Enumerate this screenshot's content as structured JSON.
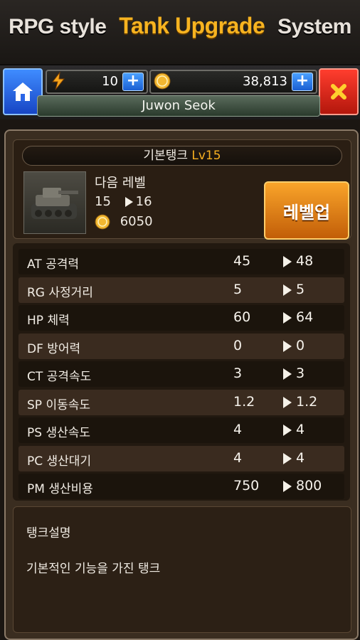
{
  "header": {
    "title_prefix": "RPG style",
    "title_accent": "Tank Upgrade",
    "title_suffix": "System"
  },
  "topbar": {
    "home_icon": "home-icon",
    "energy_value": "10",
    "gold_value": "38,813",
    "player_name": "Juwon Seok",
    "close_icon": "close-icon"
  },
  "tank": {
    "name": "기본탱크",
    "level": "Lv15",
    "next_level_label": "다음 레벨",
    "current_level": "15",
    "next_level": "16",
    "cost": "6050",
    "levelup_label": "레벨업"
  },
  "stats": [
    {
      "name": "AT 공격력",
      "current": "45",
      "next": "48"
    },
    {
      "name": "RG 사정거리",
      "current": "5",
      "next": "5"
    },
    {
      "name": "HP 체력",
      "current": "60",
      "next": "64"
    },
    {
      "name": "DF 방어력",
      "current": "0",
      "next": "0"
    },
    {
      "name": "CT 공격속도",
      "current": "3",
      "next": "3"
    },
    {
      "name": "SP 이동속도",
      "current": "1.2",
      "next": "1.2"
    },
    {
      "name": "PS 생산속도",
      "current": "4",
      "next": "4"
    },
    {
      "name": "PC 생산대기",
      "current": "4",
      "next": "4"
    },
    {
      "name": "PM 생산비용",
      "current": "750",
      "next": "800"
    }
  ],
  "description": {
    "title": "탱크설명",
    "text": "기본적인 기능을 가진 탱크"
  },
  "colors": {
    "accent": "#f7b320",
    "levelup": "#f28f1c",
    "home": "#2b66e6",
    "close": "#e0281a"
  }
}
